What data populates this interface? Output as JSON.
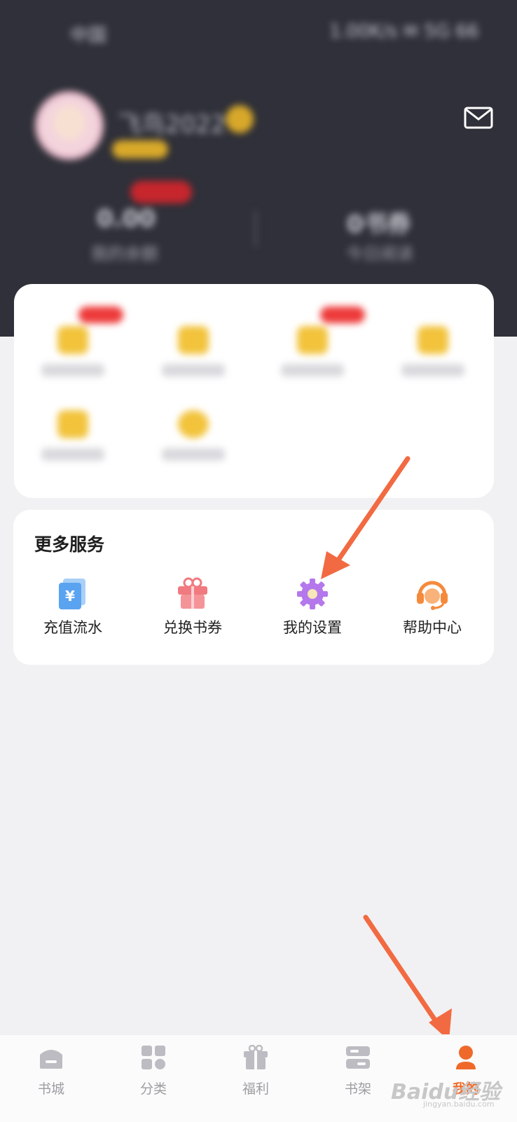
{
  "header": {
    "status_left": "中国",
    "status_right": "1.00K/s ✉ 5G 66",
    "username": "飞鸟2022",
    "stats": [
      {
        "value": "0.00",
        "label": "我的余额"
      },
      {
        "value": "0书券",
        "label": "今日阅读"
      }
    ],
    "mail_icon": "mail-icon"
  },
  "services": {
    "title": "更多服务",
    "items": [
      {
        "label": "充值流水",
        "icon": "recharge-icon",
        "color": "#5aa3f0"
      },
      {
        "label": "兑换书券",
        "icon": "gift-icon",
        "color": "#f07a80"
      },
      {
        "label": "我的设置",
        "icon": "gear-icon",
        "color": "#b477ec"
      },
      {
        "label": "帮助中心",
        "icon": "headset-icon",
        "color": "#f58a3b"
      }
    ]
  },
  "bottom_nav": {
    "items": [
      {
        "label": "书城",
        "icon": "bookstore-icon",
        "active": false
      },
      {
        "label": "分类",
        "icon": "category-icon",
        "active": false
      },
      {
        "label": "福利",
        "icon": "welfare-gift-icon",
        "active": false
      },
      {
        "label": "书架",
        "icon": "bookshelf-icon",
        "active": false
      },
      {
        "label": "我的",
        "icon": "profile-icon",
        "active": true
      }
    ]
  },
  "colors": {
    "accent": "#ef6a2a",
    "arrow": "#f26a42",
    "header_bg": "#2f3039"
  },
  "watermark": {
    "logo": "Baidu经验",
    "url": "jingyan.baidu.com"
  }
}
